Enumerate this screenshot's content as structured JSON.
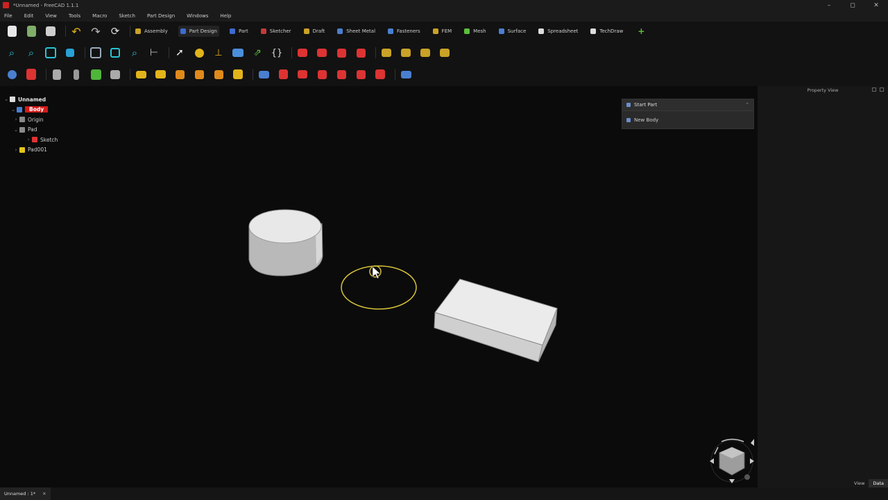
{
  "app": {
    "title": "*Unnamed - FreeCAD 1.1.1"
  },
  "window_controls": {
    "minimize": "–",
    "maximize": "◻",
    "close": "✕"
  },
  "menu": [
    "File",
    "Edit",
    "View",
    "Tools",
    "Macro",
    "Sketch",
    "Part Design",
    "Windows",
    "Help"
  ],
  "workbenches": [
    {
      "label": "Assembly",
      "color": "#c9a227"
    },
    {
      "label": "Part Design",
      "color": "#3d6bd0",
      "active": true
    },
    {
      "label": "Part",
      "color": "#3d6bd0"
    },
    {
      "label": "Sketcher",
      "color": "#c43a3a"
    },
    {
      "label": "Draft",
      "color": "#c9a227"
    },
    {
      "label": "Sheet Metal",
      "color": "#4a7fd0"
    },
    {
      "label": "Fasteners",
      "color": "#4a7fd0"
    },
    {
      "label": "FEM",
      "color": "#c9a227"
    },
    {
      "label": "Mesh",
      "color": "#5cbf3a"
    },
    {
      "label": "Surface",
      "color": "#4a7fd0"
    },
    {
      "label": "Spreadsheet",
      "color": "#dddddd"
    },
    {
      "label": "TechDraw",
      "color": "#dddddd"
    }
  ],
  "tree": {
    "root": "Unnamed",
    "items": [
      {
        "label": "Body",
        "selected": true,
        "indent": 1
      },
      {
        "label": "Origin",
        "indent": 2
      },
      {
        "label": "Pad",
        "indent": 2
      },
      {
        "label": "Sketch",
        "indent": 3
      },
      {
        "label": "Pad001",
        "indent": 2
      }
    ]
  },
  "task_panel": {
    "header": "Start Part",
    "item": "New Body",
    "collapse": "⌃"
  },
  "property_view": {
    "title": "Property View",
    "tabs": [
      "View",
      "Data"
    ]
  },
  "status": {
    "doc_tab": "Unnamed : 1*",
    "close": "✕"
  }
}
